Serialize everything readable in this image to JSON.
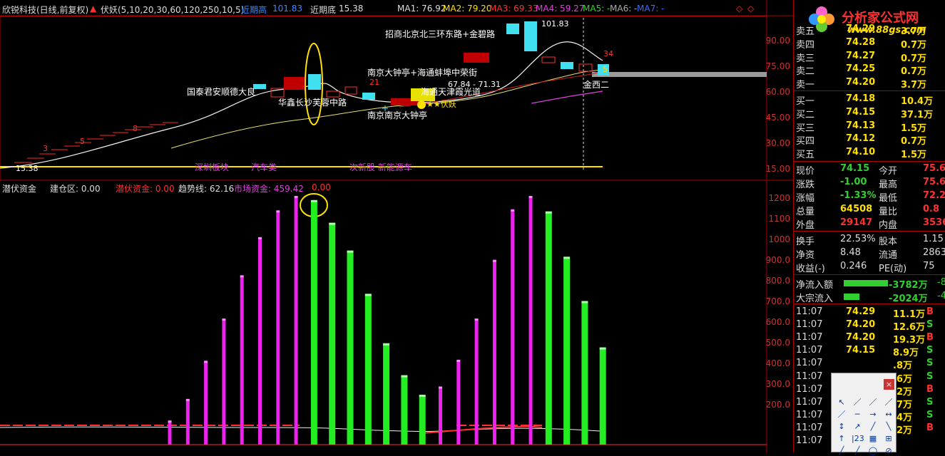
{
  "header": {
    "stock_name": "欣锐科技(日线,前复权)",
    "indicator_name": "伏妖(5,10,20,30,60,120,250,10,5)",
    "recent_high_label": "近期高",
    "recent_high_value": "101.83",
    "recent_low_label": "近期底",
    "recent_low_value": "15.38",
    "ma1": "MA1: 76.92",
    "ma2": "MA2: 79.20",
    "ma3": "MA3: 69.33",
    "ma4": "MA4: 59.27",
    "ma5": "MA5: -",
    "ma6": "MA6: -",
    "ma7": "MA7: -"
  },
  "sub_header": {
    "title": "潜伏资金",
    "jiancang": "建仓区: 0.00",
    "qianfu": "潜伏资金: 0.00",
    "trend": "趋势线: 62.16",
    "market": "市场资金: 459.42",
    "zero": "0.00"
  },
  "logo": {
    "brand": "分析家公式网",
    "url": "www.88gs.com"
  },
  "main_axis_labels": [
    "90.00",
    "75.00",
    "60.00",
    "45.00",
    "30.00",
    "15.00"
  ],
  "sub_axis_labels": [
    "1200",
    "1100",
    "1000",
    "900.0",
    "800.0",
    "700.0",
    "600.0",
    "500.0",
    "400.0",
    "300.0",
    "200.0"
  ],
  "price_annotations": {
    "high_mark": "101.83",
    "low_mark": "15.38",
    "mid_mark": "67.84 - 71.31",
    "count_3": "3",
    "count_5": "5",
    "count_8": "8",
    "count_21": "21",
    "count_34": "34",
    "count_5b": "5"
  },
  "route_labels": {
    "r1": "招商北京北三环东路+金碧路",
    "r2": "南京大钟亭+海通蚌埠中荣街",
    "r3": "国泰君安顺德大良",
    "r4": "海通天津霞光道",
    "r5": "华鑫长沙芙蓉中路",
    "r6": "南京南京大钟亭",
    "r7": "金西二",
    "r8": "★★伏妖"
  },
  "sector_labels": {
    "s1": "深圳板块",
    "s2": "汽车类",
    "s3": "次新股 新能源车"
  },
  "order_book": {
    "sell": [
      {
        "label": "卖五",
        "price": "74.29",
        "vol": "3.7万"
      },
      {
        "label": "卖四",
        "price": "74.28",
        "vol": "0.7万"
      },
      {
        "label": "卖三",
        "price": "74.27",
        "vol": "0.7万"
      },
      {
        "label": "卖二",
        "price": "74.25",
        "vol": "0.7万"
      },
      {
        "label": "卖一",
        "price": "74.20",
        "vol": "3.7万"
      }
    ],
    "buy": [
      {
        "label": "买一",
        "price": "74.18",
        "vol": "10.4万"
      },
      {
        "label": "买二",
        "price": "74.15",
        "vol": "37.1万"
      },
      {
        "label": "买三",
        "price": "74.13",
        "vol": "1.5万"
      },
      {
        "label": "买四",
        "price": "74.12",
        "vol": "0.7万"
      },
      {
        "label": "买五",
        "price": "74.10",
        "vol": "1.5万"
      }
    ]
  },
  "stats": [
    {
      "l1": "现价",
      "v1": "74.15",
      "l2": "今开",
      "v2": "75.6"
    },
    {
      "l1": "涨跌",
      "v1": "-1.00",
      "l2": "最高",
      "v2": "75.6"
    },
    {
      "l1": "涨幅",
      "v1": "-1.33%",
      "l2": "最低",
      "v2": "72.2"
    },
    {
      "l1": "总量",
      "v1": "64508",
      "l2": "量比",
      "v2": "0.8"
    },
    {
      "l1": "外盘",
      "v1": "29147",
      "l2": "内盘",
      "v2": "3536"
    }
  ],
  "stats2": [
    {
      "l1": "换手",
      "v1": "22.53%",
      "l2": "股本",
      "v2": "1.15"
    },
    {
      "l1": "净资",
      "v1": "8.48",
      "l2": "流通",
      "v2": "2863"
    },
    {
      "l1": "收益(-)",
      "v1": "0.246",
      "l2": "PE(动)",
      "v2": "75"
    }
  ],
  "flows": [
    {
      "label": "净流入额",
      "value": "-3782万",
      "tail": "-8"
    },
    {
      "label": "大宗流入",
      "value": "-2024万",
      "tail": "-4"
    }
  ],
  "ticks": [
    {
      "time": "11:07",
      "price": "74.29",
      "vol": "11.1万",
      "side": "B"
    },
    {
      "time": "11:07",
      "price": "74.20",
      "vol": "12.6万",
      "side": "S"
    },
    {
      "time": "11:07",
      "price": "74.20",
      "vol": "19.3万",
      "side": "B"
    },
    {
      "time": "11:07",
      "price": "74.15",
      "vol": "8.9万",
      "side": "S"
    },
    {
      "time": "11:07",
      "price": "",
      "vol": ".8万",
      "side": "S"
    },
    {
      "time": "11:07",
      "price": "",
      "vol": ".6万",
      "side": "S"
    },
    {
      "time": "11:07",
      "price": "",
      "vol": ".2万",
      "side": "B"
    },
    {
      "time": "11:07",
      "price": "",
      "vol": ".7万",
      "side": "S"
    },
    {
      "time": "11:07",
      "price": "",
      "vol": ".4万",
      "side": "S"
    },
    {
      "time": "11:07",
      "price": "",
      "vol": ".2万",
      "side": "B"
    },
    {
      "time": "11:07",
      "price": "",
      "vol": "",
      "side": ""
    }
  ],
  "tool_popup": {
    "close": "×",
    "tools": [
      "↖",
      "／",
      "／",
      "／",
      "／",
      "─",
      "→",
      "↔",
      "↕",
      "↗",
      "╱",
      "╲",
      "↑",
      "|23",
      "▦",
      "⊞",
      "╱",
      "╱",
      "◯",
      "⊘"
    ]
  },
  "chart_data": [
    {
      "type": "candlestick",
      "y_axis_ticks": [
        90,
        75,
        60,
        45,
        30,
        15
      ],
      "ylim": [
        12,
        104
      ],
      "annotations": [
        "101.83",
        "15.38",
        "67.84 - 71.31"
      ]
    },
    {
      "type": "bar",
      "title": "潜伏资金",
      "y_axis_ticks": [
        1200,
        1100,
        1000,
        900,
        800,
        700,
        600,
        500,
        400,
        300,
        200
      ],
      "ylim": [
        100,
        1220
      ],
      "values": [
        110,
        215,
        400,
        605,
        815,
        1000,
        1130,
        1200,
        1180,
        1070,
        935,
        725,
        485,
        330,
        235,
        275,
        405,
        605,
        890,
        1135,
        1200,
        1125,
        905,
        690,
        465
      ],
      "colors": [
        "m",
        "m",
        "m",
        "m",
        "m",
        "m",
        "m",
        "m",
        "g",
        "g",
        "g",
        "g",
        "g",
        "g",
        "g",
        "m",
        "m",
        "m",
        "m",
        "m",
        "m",
        "g",
        "g",
        "g",
        "g"
      ]
    }
  ]
}
